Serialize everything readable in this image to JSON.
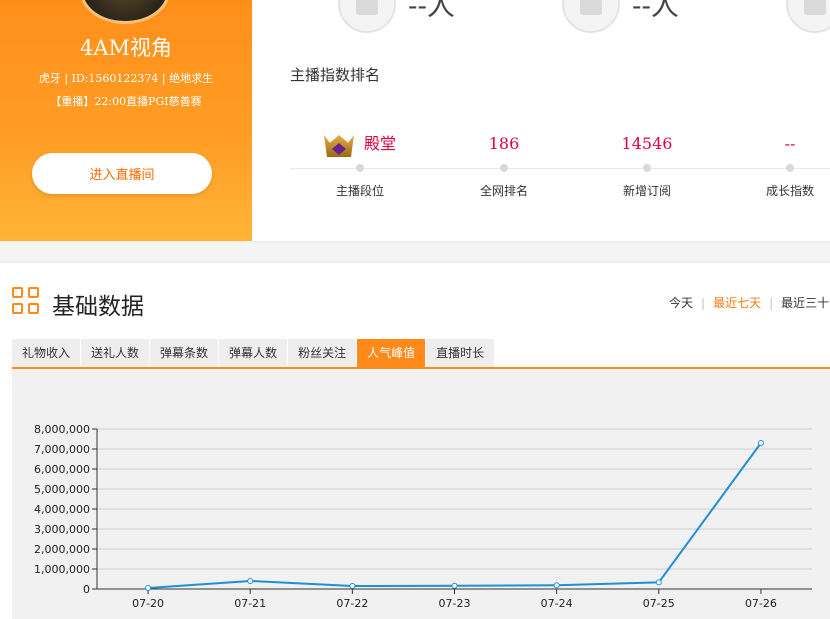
{
  "profile": {
    "name": "4AM视角",
    "meta": "虎牙 | ID:1560122374 | 绝地求生",
    "show": "【重播】22:00直播PGI慈善赛",
    "enter_label": "进入直播间"
  },
  "top_stats": [
    {
      "value": "--人"
    },
    {
      "value": "--人"
    }
  ],
  "rank": {
    "title": "主播指数排名",
    "items": [
      {
        "value": "殿堂",
        "label": "主播段位"
      },
      {
        "value": "186",
        "label": "全网排名"
      },
      {
        "value": "14546",
        "label": "新增订阅"
      },
      {
        "value": "--",
        "label": "成长指数"
      }
    ]
  },
  "basic": {
    "title": "基础数据",
    "ranges": [
      "今天",
      "最近七天",
      "最近三十"
    ],
    "active_range": 1,
    "tabs": [
      "礼物收入",
      "送礼人数",
      "弹幕条数",
      "弹幕人数",
      "粉丝关注",
      "人气峰值",
      "直播时长"
    ],
    "active_tab": 5
  },
  "colors": {
    "accent": "#ff8a1a",
    "rank_value": "#e0003c",
    "line": "#1f8fd6"
  },
  "chart_data": {
    "type": "line",
    "x": [
      "07-20",
      "07-21",
      "07-22",
      "07-23",
      "07-24",
      "07-25",
      "07-26"
    ],
    "series": [
      {
        "values": [
          50000,
          400000,
          150000,
          160000,
          190000,
          330000,
          7300000
        ]
      }
    ],
    "yticks": [
      "0",
      "1,000,000",
      "2,000,000",
      "3,000,000",
      "4,000,000",
      "5,000,000",
      "6,000,000",
      "7,000,000",
      "8,000,000"
    ],
    "ylim": [
      0,
      8000000
    ],
    "grid": true
  }
}
